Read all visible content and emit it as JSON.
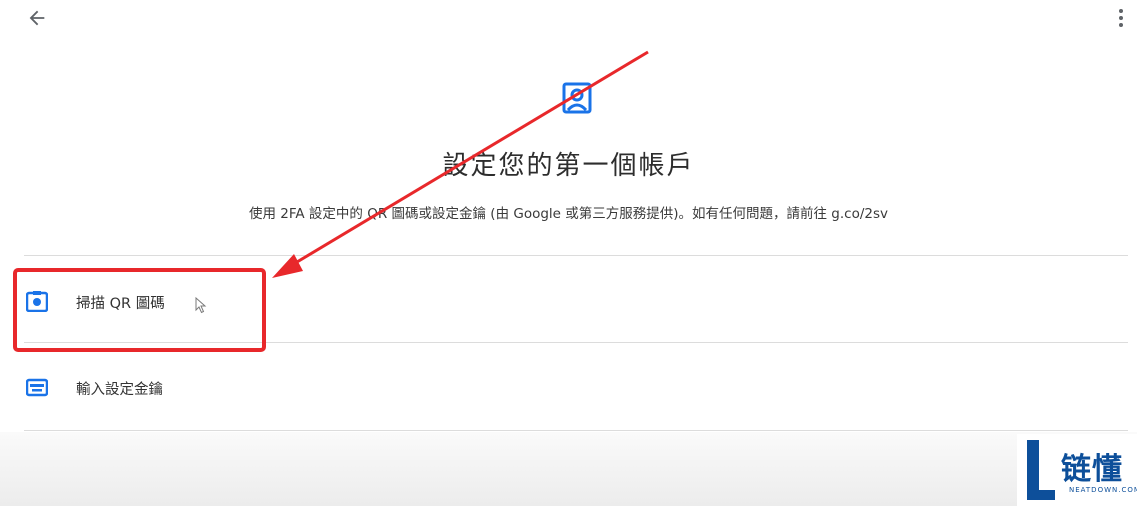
{
  "header": {
    "title": "設定您的第一個帳戶",
    "description": "使用 2FA 設定中的 QR 圖碼或設定金鑰 (由 Google 或第三方服務提供)。如有任何問題，請前往 g.co/2sv"
  },
  "options": [
    {
      "label": "掃描 QR 圖碼",
      "icon": "camera-icon"
    },
    {
      "label": "輸入設定金鑰",
      "icon": "keyboard-icon"
    }
  ],
  "watermark": {
    "brand_cn": "链懂",
    "brand_en": "NEATDOWN.COM"
  },
  "colors": {
    "accent_blue": "#1a73e8",
    "annotation_red": "#e8282b",
    "watermark_blue": "#0d4f9a"
  }
}
